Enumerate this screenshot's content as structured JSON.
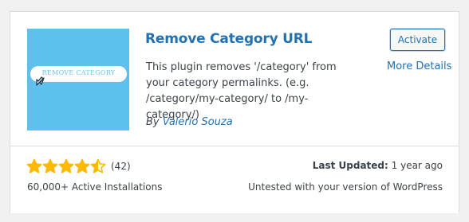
{
  "plugin": {
    "title": "Remove Category URL",
    "description": "This plugin removes '/category' from your category permalinks. (e.g. /category/my-category/ to /my-category/)",
    "author_prefix": "By",
    "author_name": "Valerio Souza",
    "thumbnail": {
      "text": "REMOVE CATEGORY",
      "background": "#5ec0ec",
      "icon": "cursor-arrow-icon"
    }
  },
  "actions": {
    "activate_label": "Activate",
    "more_details_label": "More Details"
  },
  "footer": {
    "rating": {
      "stars": 4.5,
      "max": 5,
      "count_label": "(42)",
      "star_color": "#ffb900"
    },
    "installs": "60,000+ Active Installations",
    "last_updated_label": "Last Updated:",
    "last_updated_value": "1 year ago",
    "compatibility": "Untested with your version of WordPress"
  },
  "colors": {
    "link": "#2271b1",
    "text": "#3c434a",
    "border": "#dcdcde",
    "page_bg": "#f1f1f1"
  }
}
